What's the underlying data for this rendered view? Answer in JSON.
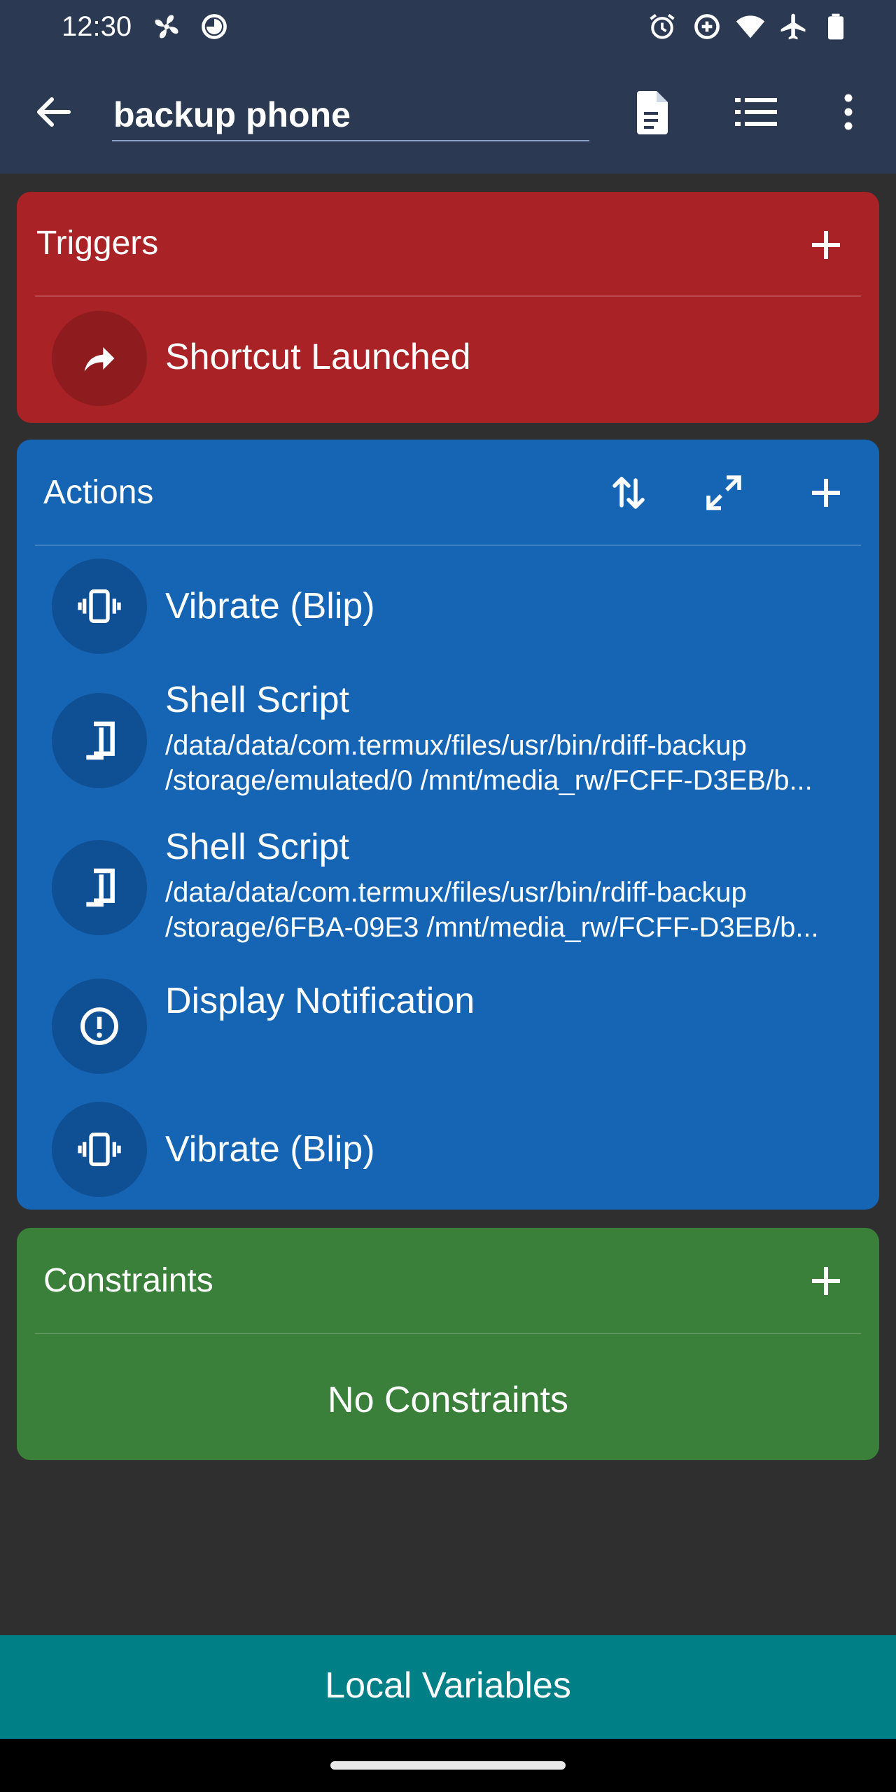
{
  "status_bar": {
    "time": "12:30",
    "left_icons": [
      "fan-icon",
      "data-saver-icon"
    ],
    "right_icons": [
      "alarm-icon",
      "hotspot-icon",
      "wifi-icon",
      "airplane-icon",
      "battery-icon"
    ]
  },
  "toolbar": {
    "back_icon": "arrow-left-icon",
    "title_value": "backup phone",
    "actions": [
      "document-icon",
      "list-icon",
      "more-vert-icon"
    ]
  },
  "triggers": {
    "title": "Triggers",
    "color": "#a92226",
    "items": [
      {
        "label": "Shortcut Launched",
        "icon": "share-arrow-icon"
      }
    ]
  },
  "actions": {
    "title": "Actions",
    "color": "#1565b4",
    "items": [
      {
        "label": "Vibrate (Blip)",
        "icon": "vibrate-icon"
      },
      {
        "label": "Shell Script",
        "icon": "shell-icon",
        "detail": "/data/data/com.termux/files/usr/bin/rdiff-backup /storage/emulated/0 /mnt/media_rw/FCFF-D3EB/b..."
      },
      {
        "label": "Shell Script",
        "icon": "shell-icon",
        "detail": "/data/data/com.termux/files/usr/bin/rdiff-backup /storage/6FBA-09E3 /mnt/media_rw/FCFF-D3EB/b..."
      },
      {
        "label": "Display Notification",
        "icon": "alert-circle-icon"
      },
      {
        "label": "Vibrate (Blip)",
        "icon": "vibrate-icon"
      }
    ]
  },
  "constraints": {
    "title": "Constraints",
    "color": "#3a7f3a",
    "empty_text": "No Constraints"
  },
  "bottom_bar": {
    "label": "Local Variables",
    "color": "#007f86"
  }
}
